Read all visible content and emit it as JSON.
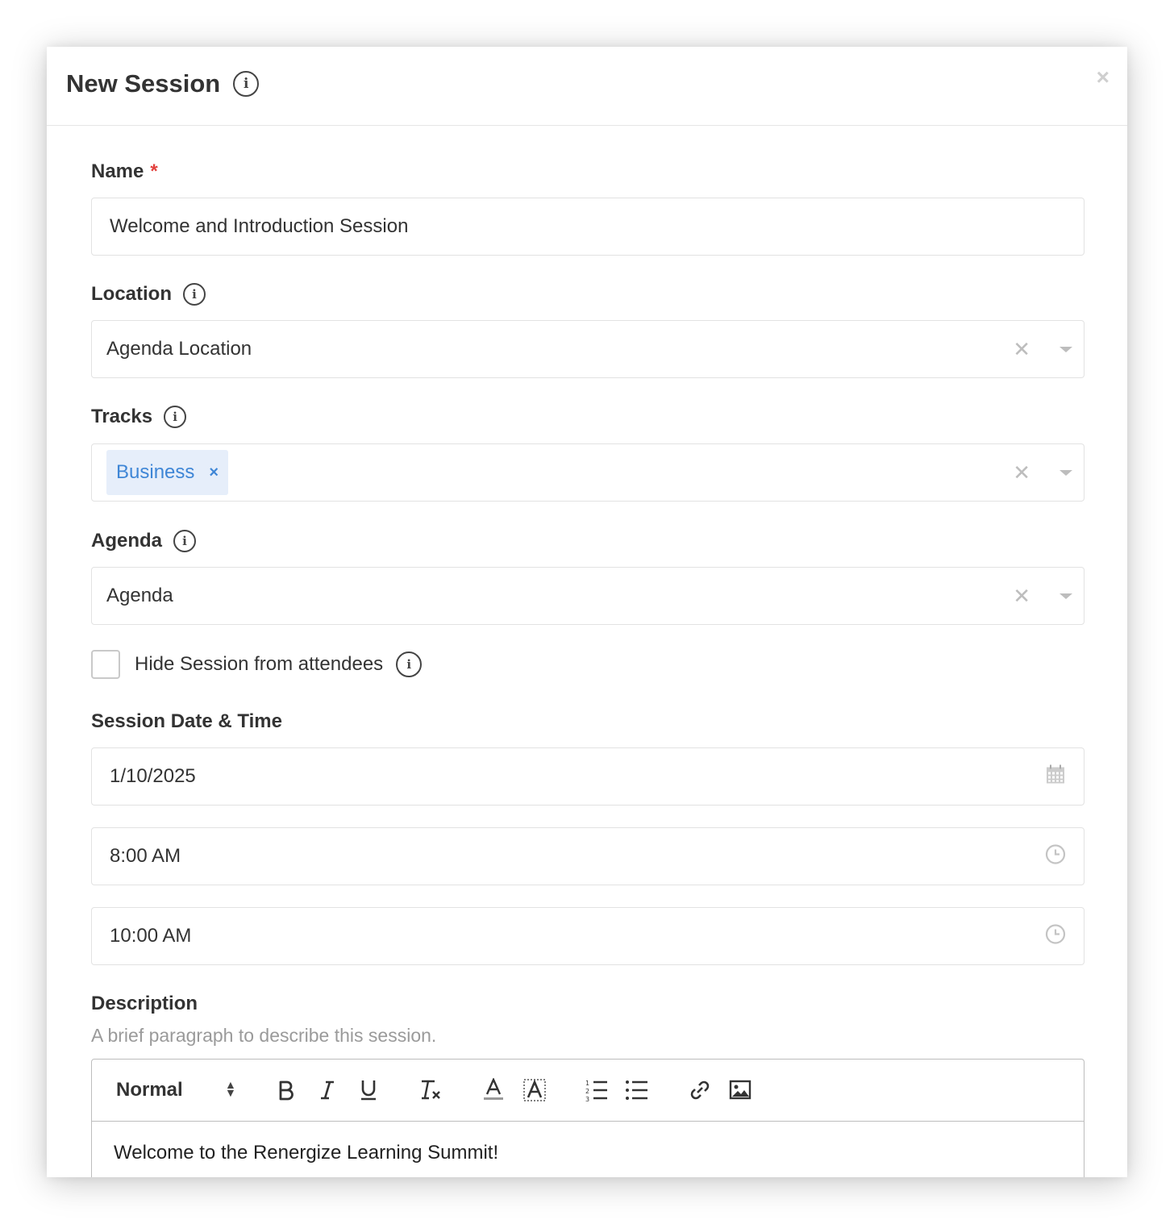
{
  "modal": {
    "title": "New Session",
    "close_label": "×"
  },
  "form": {
    "name": {
      "label": "Name",
      "required_mark": "*",
      "value": "Welcome and Introduction Session"
    },
    "location": {
      "label": "Location",
      "value": "Agenda Location"
    },
    "tracks": {
      "label": "Tracks",
      "tags": [
        "Business"
      ],
      "tag_remove": "×"
    },
    "agenda": {
      "label": "Agenda",
      "value": "Agenda"
    },
    "hide_session": {
      "label": "Hide Session from attendees",
      "checked": false
    },
    "session_datetime": {
      "label": "Session Date & Time",
      "date": "1/10/2025",
      "start_time": "8:00 AM",
      "end_time": "10:00 AM"
    },
    "description": {
      "label": "Description",
      "hint": "A brief paragraph to describe this session.",
      "format_select": "Normal",
      "content": "Welcome to the Renergize Learning Summit!"
    }
  },
  "icons": {
    "info": "info-icon",
    "clear": "clear-icon",
    "dropdown": "caret-down-icon",
    "calendar": "calendar-icon",
    "clock": "clock-icon"
  },
  "colors": {
    "required": "#e2403d",
    "tag_bg": "#e6eefa",
    "tag_text": "#3f86d6",
    "border": "#e2e2e2",
    "hint": "#9a9a9a"
  }
}
